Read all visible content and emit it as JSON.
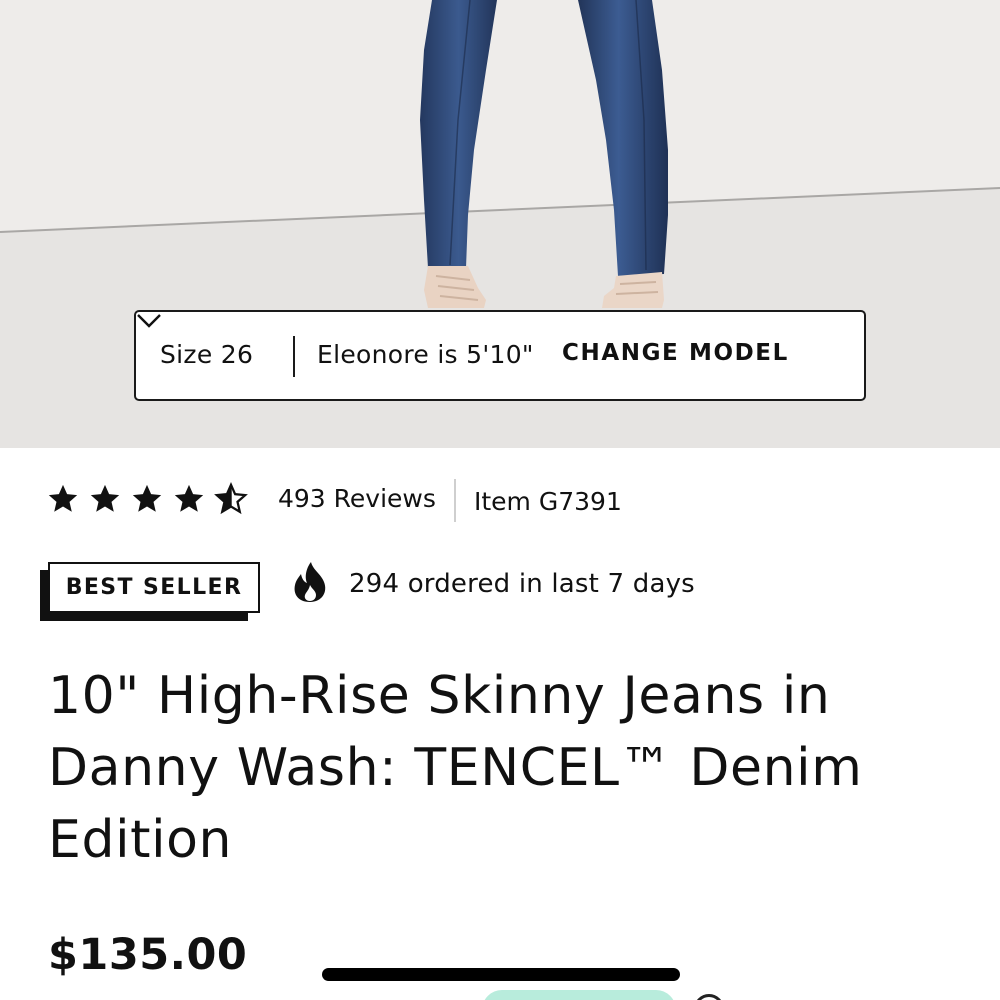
{
  "model_selector": {
    "size_label": "Size 26",
    "model_height": "Eleonore is 5'10\"",
    "change_model_label": "CHANGE MODEL",
    "chevron_icon": "chevron-down-icon"
  },
  "rating": {
    "stars": 4.5,
    "star_icon": "star-icon",
    "reviews_label": "493 Reviews",
    "item_number": "Item G7391"
  },
  "badges": {
    "best_seller_label": "BEST SELLER",
    "flame_icon": "flame-icon",
    "ordered_text": "294 ordered in last 7 days"
  },
  "product": {
    "title": "10\" High-Rise Skinny Jeans in Danny Wash: TENCEL™ Denim Edition",
    "price": "$135.00"
  },
  "colors": {
    "hero_background": "#eceae8",
    "denim": "#2f4a78",
    "mint_accent": "#b8ecdc",
    "text": "#111111"
  }
}
